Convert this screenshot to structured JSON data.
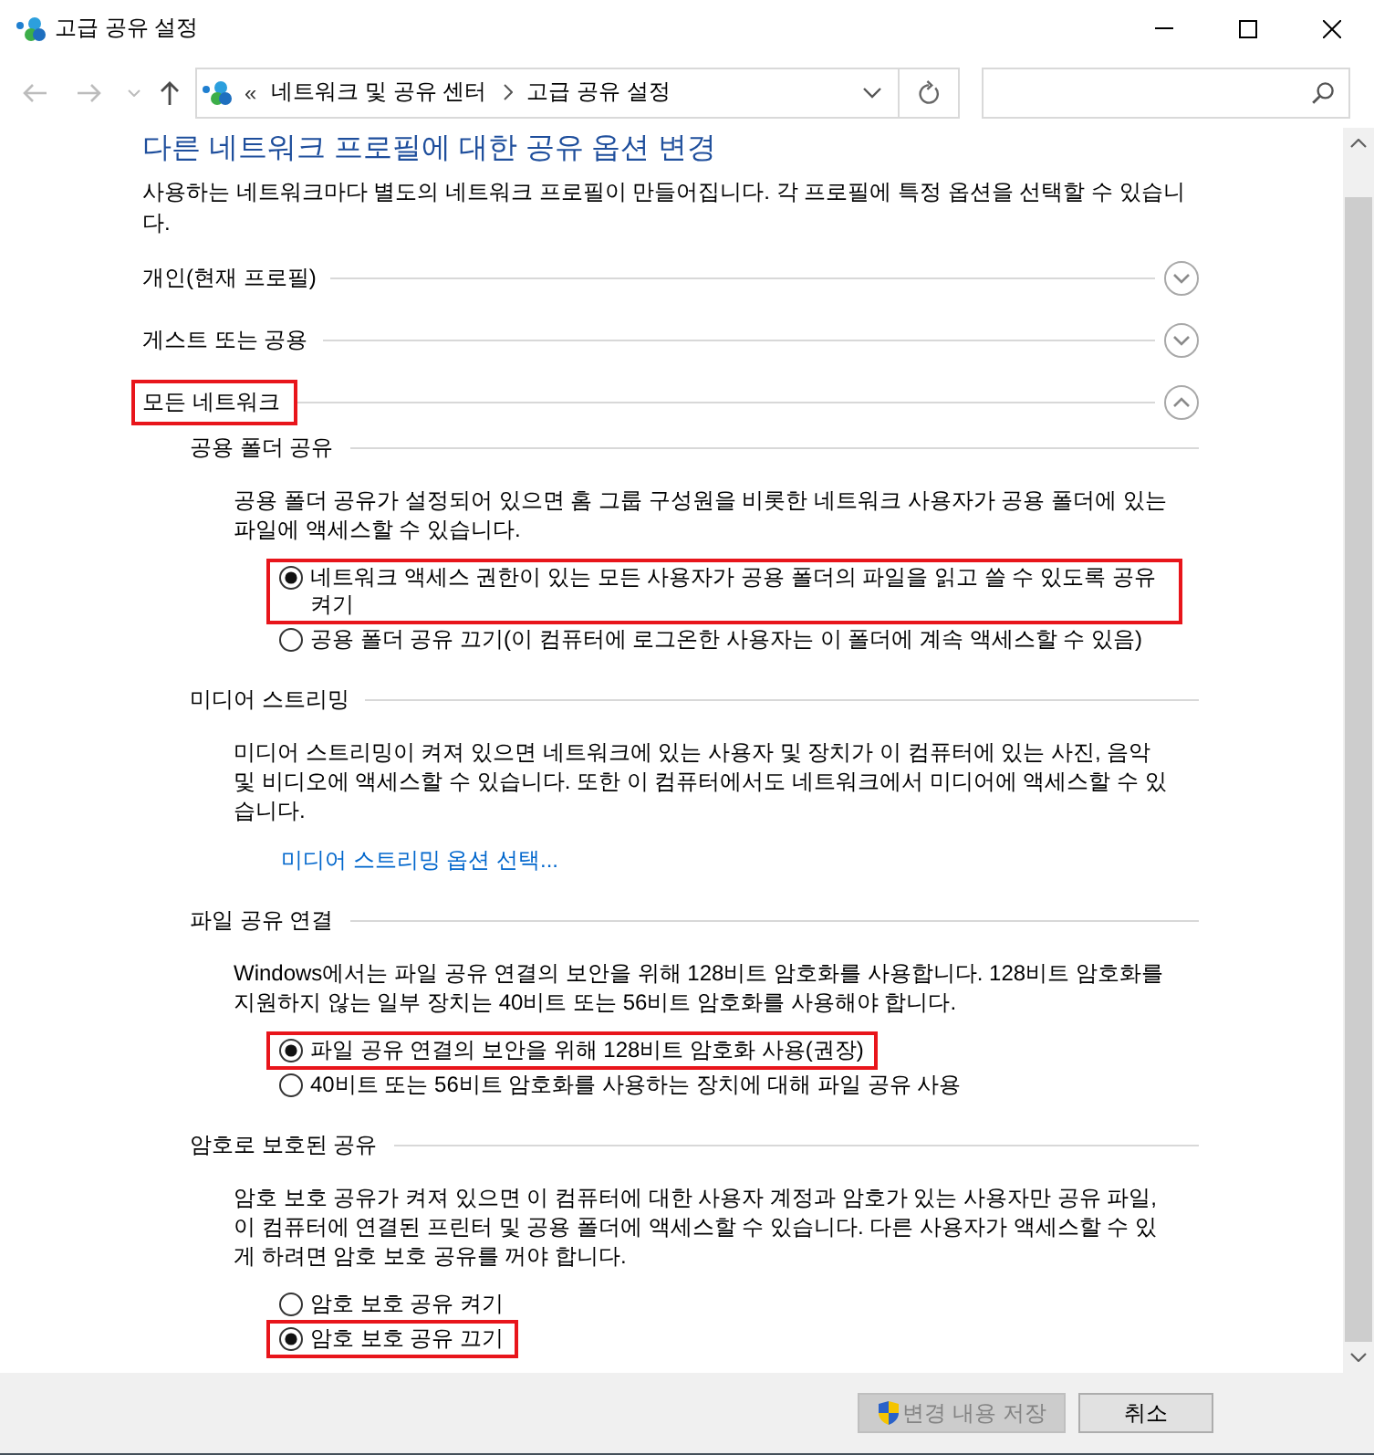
{
  "window": {
    "title": "고급 공유 설정"
  },
  "navigation": [
    {
      "kind": "back",
      "disabled": true
    },
    {
      "kind": "forward",
      "disabled": true
    },
    {
      "kind": "recent",
      "disabled": true
    },
    {
      "kind": "up",
      "disabled": false
    }
  ],
  "address_bar": {
    "overflow": "«",
    "crumbs": [
      "네트워크 및 공유 센터",
      "고급 공유 설정"
    ]
  },
  "heading": "다른 네트워크 프로필에 대한 공유 옵션 변경",
  "description": "사용하는 네트워크마다 별도의 네트워크 프로필이 만들어집니다. 각 프로필에 특정 옵션을 선택할 수 있습니다.",
  "profiles": [
    {
      "label": "개인(현재 프로필)",
      "expanded": false,
      "highlighted": false
    },
    {
      "label": "게스트 또는 공용",
      "expanded": false,
      "highlighted": false
    },
    {
      "label": "모든 네트워크",
      "expanded": true,
      "highlighted": true,
      "sections": [
        {
          "title": "공용 폴더 공유",
          "description": "공용 폴더 공유가 설정되어 있으면 홈 그룹 구성원을 비롯한 네트워크 사용자가 공용 폴더에 있는 파일에 액세스할 수 있습니다.",
          "options": [
            {
              "label": "네트워크 액세스 권한이 있는 모든 사용자가 공용 폴더의 파일을 읽고 쓸 수 있도록 공유 켜기",
              "selected": true,
              "highlighted": true
            },
            {
              "label": "공용 폴더 공유 끄기(이 컴퓨터에 로그온한 사용자는 이 폴더에 계속 액세스할 수 있음)",
              "selected": false,
              "highlighted": false
            }
          ]
        },
        {
          "title": "미디어 스트리밍",
          "description": "미디어 스트리밍이 켜져 있으면 네트워크에 있는 사용자 및 장치가 이 컴퓨터에 있는 사진, 음악 및 비디오에 액세스할 수 있습니다. 또한 이 컴퓨터에서도 네트워크에서 미디어에 액세스할 수 있습니다.",
          "link": "미디어 스트리밍 옵션 선택..."
        },
        {
          "title": "파일 공유 연결",
          "description": "Windows에서는 파일 공유 연결의 보안을 위해 128비트 암호화를 사용합니다. 128비트 암호화를 지원하지 않는 일부 장치는 40비트 또는 56비트 암호화를 사용해야 합니다.",
          "options": [
            {
              "label": "파일 공유 연결의 보안을 위해 128비트 암호화 사용(권장)",
              "selected": true,
              "highlighted": true
            },
            {
              "label": "40비트 또는 56비트 암호화를 사용하는 장치에 대해 파일 공유 사용",
              "selected": false,
              "highlighted": false
            }
          ]
        },
        {
          "title": "암호로 보호된 공유",
          "description": "암호 보호 공유가 켜져 있으면 이 컴퓨터에 대한 사용자 계정과 암호가 있는 사용자만 공유 파일, 이 컴퓨터에 연결된 프린터 및 공용 폴더에 액세스할 수 있습니다. 다른 사용자가 액세스할 수 있게 하려면 암호 보호 공유를 꺼야 합니다.",
          "options": [
            {
              "label": "암호 보호 공유 켜기",
              "selected": false,
              "highlighted": false
            },
            {
              "label": "암호 보호 공유 끄기",
              "selected": true,
              "highlighted": true
            }
          ]
        }
      ]
    }
  ],
  "buttons": [
    {
      "label": "변경 내용 저장",
      "kind": "elevated",
      "disabled": true
    },
    {
      "label": "취소",
      "kind": "plain",
      "disabled": false
    }
  ]
}
